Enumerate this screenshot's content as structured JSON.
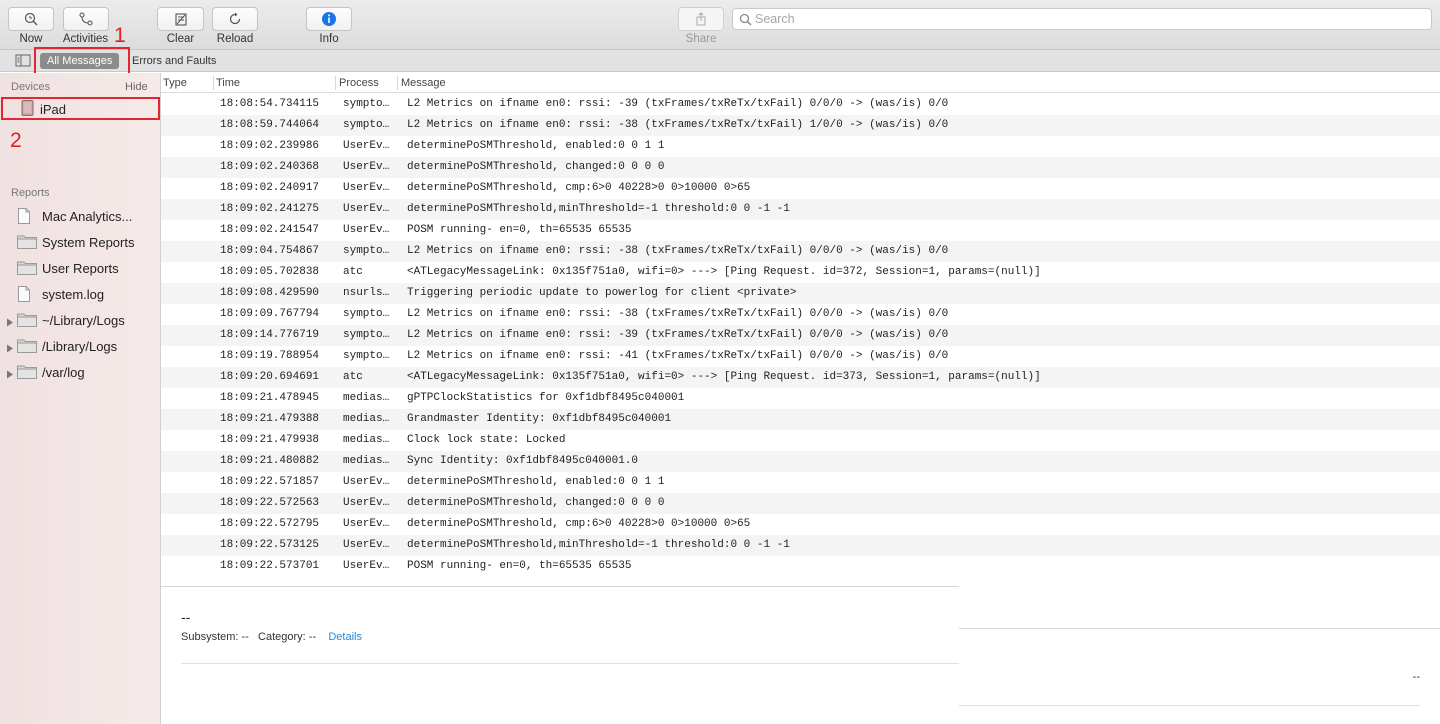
{
  "toolbar": {
    "now_label": "Now",
    "activities_label": "Activities",
    "clear_label": "Clear",
    "reload_label": "Reload",
    "info_label": "Info",
    "share_label": "Share",
    "search_placeholder": "Search"
  },
  "annotations": {
    "marker1": "1",
    "marker2": "2"
  },
  "filter": {
    "all_messages": "All Messages",
    "errors_faults": "Errors and Faults"
  },
  "sidebar": {
    "devices_header": "Devices",
    "hide_label": "Hide",
    "device": "iPad",
    "reports_header": "Reports",
    "reports": [
      {
        "label": "Mac Analytics...",
        "icon": "document-icon"
      },
      {
        "label": "System Reports",
        "icon": "folder-icon"
      },
      {
        "label": "User Reports",
        "icon": "folder-icon"
      },
      {
        "label": "system.log",
        "icon": "document-icon"
      },
      {
        "label": "~/Library/Logs",
        "icon": "folder-icon"
      },
      {
        "label": "/Library/Logs",
        "icon": "folder-icon"
      },
      {
        "label": "/var/log",
        "icon": "folder-icon"
      }
    ]
  },
  "table": {
    "columns": [
      "Type",
      "Time",
      "Process",
      "Message"
    ],
    "rows": [
      {
        "time": "18:08:54.734115",
        "process": "sympto…",
        "message": "L2 Metrics on ifname en0: rssi: -39 (txFrames/txReTx/txFail) 0/0/0 -> (was/is) 0/0"
      },
      {
        "time": "18:08:59.744064",
        "process": "sympto…",
        "message": "L2 Metrics on ifname en0: rssi: -38 (txFrames/txReTx/txFail) 1/0/0 -> (was/is) 0/0"
      },
      {
        "time": "18:09:02.239986",
        "process": "UserEv…",
        "message": "determinePoSMThreshold, enabled:0 0 1 1"
      },
      {
        "time": "18:09:02.240368",
        "process": "UserEv…",
        "message": "determinePoSMThreshold, changed:0 0 0 0"
      },
      {
        "time": "18:09:02.240917",
        "process": "UserEv…",
        "message": "determinePoSMThreshold, cmp:6>0 40228>0 0>10000 0>65"
      },
      {
        "time": "18:09:02.241275",
        "process": "UserEv…",
        "message": "determinePoSMThreshold,minThreshold=-1 threshold:0 0 -1 -1"
      },
      {
        "time": "18:09:02.241547",
        "process": "UserEv…",
        "message": "POSM running- en=0, th=65535 65535"
      },
      {
        "time": "18:09:04.754867",
        "process": "sympto…",
        "message": "L2 Metrics on ifname en0: rssi: -38 (txFrames/txReTx/txFail) 0/0/0 -> (was/is) 0/0"
      },
      {
        "time": "18:09:05.702838",
        "process": "atc",
        "message": "<ATLegacyMessageLink: 0x135f751a0, wifi=0> ---> [Ping Request. id=372, Session=1, params=(null)]"
      },
      {
        "time": "18:09:08.429590",
        "process": "nsurls…",
        "message": "Triggering periodic update to powerlog for client <private>"
      },
      {
        "time": "18:09:09.767794",
        "process": "sympto…",
        "message": "L2 Metrics on ifname en0: rssi: -38 (txFrames/txReTx/txFail) 0/0/0 -> (was/is) 0/0"
      },
      {
        "time": "18:09:14.776719",
        "process": "sympto…",
        "message": "L2 Metrics on ifname en0: rssi: -39 (txFrames/txReTx/txFail) 0/0/0 -> (was/is) 0/0"
      },
      {
        "time": "18:09:19.788954",
        "process": "sympto…",
        "message": "L2 Metrics on ifname en0: rssi: -41 (txFrames/txReTx/txFail) 0/0/0 -> (was/is) 0/0"
      },
      {
        "time": "18:09:20.694691",
        "process": "atc",
        "message": "<ATLegacyMessageLink: 0x135f751a0, wifi=0> ---> [Ping Request. id=373, Session=1, params=(null)]"
      },
      {
        "time": "18:09:21.478945",
        "process": "medias…",
        "message": "gPTPClockStatistics for 0xf1dbf8495c040001"
      },
      {
        "time": "18:09:21.479388",
        "process": "medias…",
        "message": "Grandmaster Identity: 0xf1dbf8495c040001"
      },
      {
        "time": "18:09:21.479938",
        "process": "medias…",
        "message": "Clock lock state: Locked"
      },
      {
        "time": "18:09:21.480882",
        "process": "medias…",
        "message": "Sync Identity: 0xf1dbf8495c040001.0"
      },
      {
        "time": "18:09:22.571857",
        "process": "UserEv…",
        "message": "determinePoSMThreshold, enabled:0 0 1 1"
      },
      {
        "time": "18:09:22.572563",
        "process": "UserEv…",
        "message": "determinePoSMThreshold, changed:0 0 0 0"
      },
      {
        "time": "18:09:22.572795",
        "process": "UserEv…",
        "message": "determinePoSMThreshold, cmp:6>0 40228>0 0>10000 0>65"
      },
      {
        "time": "18:09:22.573125",
        "process": "UserEv…",
        "message": "determinePoSMThreshold,minThreshold=-1 threshold:0 0 -1 -1"
      },
      {
        "time": "18:09:22.573701",
        "process": "UserEv…",
        "message": "POSM running- en=0, th=65535 65535"
      }
    ]
  },
  "detail": {
    "title": "--",
    "subsystem_label": "Subsystem: --",
    "category_label": "Category: --",
    "details_link": "Details",
    "right_value": "--"
  },
  "colors": {
    "highlight_red": "#e0272f",
    "link_blue": "#2a8ad8",
    "info_blue": "#1a73e8"
  }
}
